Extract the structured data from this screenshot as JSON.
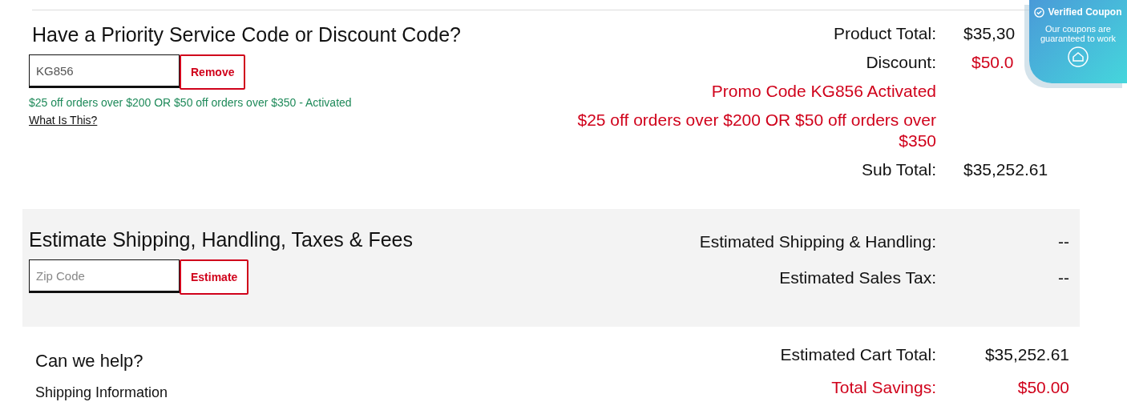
{
  "discount_code": {
    "title": "Have a Priority Service Code or Discount Code?",
    "value": "KG856",
    "button": "Remove",
    "message": "$25 off orders over $200 OR $50 off orders over $350 - Activated",
    "help_link": "What Is This?"
  },
  "summary": [
    {
      "kind": "amount",
      "label": "Product Total:",
      "value": "$35,30"
    },
    {
      "kind": "discount",
      "label": "Discount:",
      "value": "$50.0"
    },
    {
      "kind": "note",
      "label": "Promo Code KG856  Activated"
    },
    {
      "kind": "note",
      "label": "$25 off orders over $200 OR $50 off orders over $350"
    },
    {
      "kind": "amount",
      "label": "Sub Total:",
      "value": "$35,252.61"
    }
  ],
  "shipping": {
    "title": "Estimate Shipping, Handling, Taxes & Fees",
    "placeholder": "Zip Code",
    "button": "Estimate",
    "rows": [
      {
        "label": "Estimated Shipping & Handling:",
        "value": "--"
      },
      {
        "label": "Estimated Sales Tax:",
        "value": "--"
      }
    ]
  },
  "help": {
    "title": "Can we help?",
    "links": [
      "Shipping Information"
    ]
  },
  "cart_totals": [
    {
      "kind": "total",
      "label": "Estimated Cart Total:",
      "value": "$35,252.61"
    },
    {
      "kind": "savings",
      "label": "Total Savings:",
      "value": "$50.00"
    }
  ],
  "coupon_badge": {
    "title": "Verified Coupon",
    "text": "Our coupons are guaranteed to work"
  }
}
